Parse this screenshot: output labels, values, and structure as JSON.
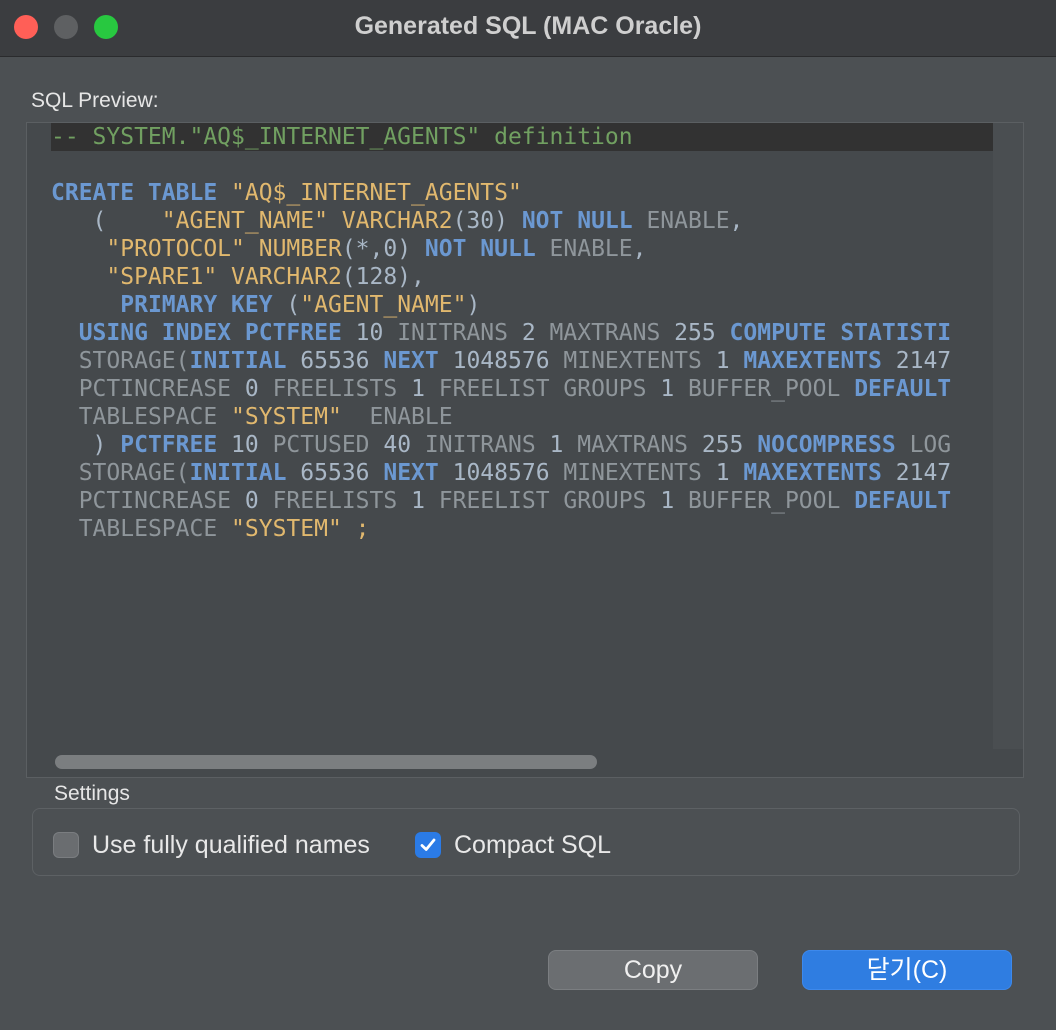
{
  "window": {
    "title": "Generated SQL (MAC Oracle)"
  },
  "preview": {
    "label": "SQL Preview:",
    "lines": [
      [
        [
          "-- SYSTEM.\"AQ$_INTERNET_AGENTS\" definition",
          "cm"
        ]
      ],
      [],
      [
        [
          "CREATE TABLE ",
          "kw"
        ],
        [
          "\"AQ$_INTERNET_AGENTS\"",
          "str"
        ]
      ],
      [
        [
          "   (    ",
          "tx"
        ],
        [
          "\"AGENT_NAME\" ",
          "str"
        ],
        [
          "VARCHAR2",
          "str"
        ],
        [
          "(30) ",
          "tx"
        ],
        [
          "NOT NULL ",
          "kw"
        ],
        [
          "ENABLE",
          "gy"
        ],
        [
          ",",
          "tx"
        ]
      ],
      [
        [
          "    ",
          "tx"
        ],
        [
          "\"PROTOCOL\" ",
          "str"
        ],
        [
          "NUMBER",
          "str"
        ],
        [
          "(*,0) ",
          "tx"
        ],
        [
          "NOT NULL ",
          "kw"
        ],
        [
          "ENABLE",
          "gy"
        ],
        [
          ",",
          "tx"
        ]
      ],
      [
        [
          "    ",
          "tx"
        ],
        [
          "\"SPARE1\" ",
          "str"
        ],
        [
          "VARCHAR2",
          "str"
        ],
        [
          "(128),",
          "tx"
        ]
      ],
      [
        [
          "     ",
          "tx"
        ],
        [
          "PRIMARY KEY ",
          "kw"
        ],
        [
          "(",
          "tx"
        ],
        [
          "\"AGENT_NAME\"",
          "str"
        ],
        [
          ")",
          "tx"
        ]
      ],
      [
        [
          "  ",
          "tx"
        ],
        [
          "USING INDEX PCTFREE ",
          "kw"
        ],
        [
          "10 ",
          "tx"
        ],
        [
          "INITRANS ",
          "gy"
        ],
        [
          "2 ",
          "tx"
        ],
        [
          "MAXTRANS ",
          "gy"
        ],
        [
          "255 ",
          "tx"
        ],
        [
          "COMPUTE STATISTI",
          "kw"
        ]
      ],
      [
        [
          "  ",
          "tx"
        ],
        [
          "STORAGE(",
          "gy"
        ],
        [
          "INITIAL ",
          "kw"
        ],
        [
          "65536 ",
          "tx"
        ],
        [
          "NEXT ",
          "kw"
        ],
        [
          "1048576 ",
          "tx"
        ],
        [
          "MINEXTENTS ",
          "gy"
        ],
        [
          "1 ",
          "tx"
        ],
        [
          "MAXEXTENTS ",
          "kw"
        ],
        [
          "2147",
          "tx"
        ]
      ],
      [
        [
          "  ",
          "tx"
        ],
        [
          "PCTINCREASE ",
          "gy"
        ],
        [
          "0 ",
          "tx"
        ],
        [
          "FREELISTS ",
          "gy"
        ],
        [
          "1 ",
          "tx"
        ],
        [
          "FREELIST GROUPS ",
          "gy"
        ],
        [
          "1 ",
          "tx"
        ],
        [
          "BUFFER_POOL ",
          "gy"
        ],
        [
          "DEFAULT",
          "kw"
        ]
      ],
      [
        [
          "  ",
          "tx"
        ],
        [
          "TABLESPACE ",
          "gy"
        ],
        [
          "\"SYSTEM\"",
          "str"
        ],
        [
          "  ENABLE",
          "gy"
        ]
      ],
      [
        [
          "   ) ",
          "tx"
        ],
        [
          "PCTFREE ",
          "kw"
        ],
        [
          "10 ",
          "tx"
        ],
        [
          "PCTUSED ",
          "gy"
        ],
        [
          "40 ",
          "tx"
        ],
        [
          "INITRANS ",
          "gy"
        ],
        [
          "1 ",
          "tx"
        ],
        [
          "MAXTRANS ",
          "gy"
        ],
        [
          "255 ",
          "tx"
        ],
        [
          "NOCOMPRESS ",
          "kw"
        ],
        [
          "LOG",
          "gy"
        ]
      ],
      [
        [
          "  ",
          "tx"
        ],
        [
          "STORAGE(",
          "gy"
        ],
        [
          "INITIAL ",
          "kw"
        ],
        [
          "65536 ",
          "tx"
        ],
        [
          "NEXT ",
          "kw"
        ],
        [
          "1048576 ",
          "tx"
        ],
        [
          "MINEXTENTS ",
          "gy"
        ],
        [
          "1 ",
          "tx"
        ],
        [
          "MAXEXTENTS ",
          "kw"
        ],
        [
          "2147",
          "tx"
        ]
      ],
      [
        [
          "  ",
          "tx"
        ],
        [
          "PCTINCREASE ",
          "gy"
        ],
        [
          "0 ",
          "tx"
        ],
        [
          "FREELISTS ",
          "gy"
        ],
        [
          "1 ",
          "tx"
        ],
        [
          "FREELIST GROUPS ",
          "gy"
        ],
        [
          "1 ",
          "tx"
        ],
        [
          "BUFFER_POOL ",
          "gy"
        ],
        [
          "DEFAULT",
          "kw"
        ]
      ],
      [
        [
          "  ",
          "tx"
        ],
        [
          "TABLESPACE ",
          "gy"
        ],
        [
          "\"SYSTEM\" ;",
          "str"
        ]
      ]
    ]
  },
  "settings": {
    "label": "Settings",
    "options": [
      {
        "label": "Use fully qualified names",
        "checked": false
      },
      {
        "label": "Compact SQL",
        "checked": true
      }
    ]
  },
  "buttons": {
    "copy": "Copy",
    "close": "닫기(C)"
  },
  "colors": {
    "comment": "#71a061",
    "keyword": "#6b98d1",
    "string": "#e1b86e",
    "text": "#a9b7c6",
    "muted": "#8f969b",
    "accent": "#2f7de1"
  }
}
